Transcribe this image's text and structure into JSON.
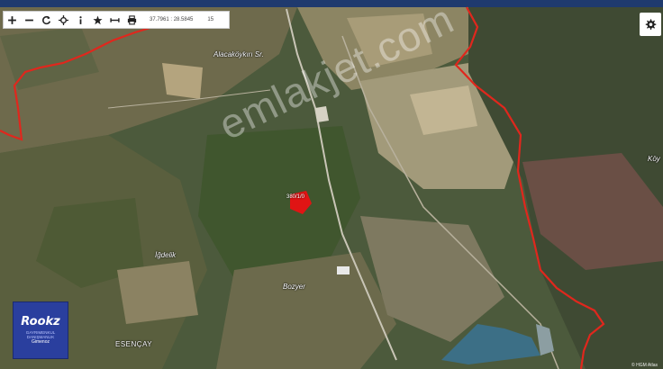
{
  "map": {
    "toolbar": {
      "tools": [
        {
          "name": "zoom-in-icon",
          "glyph": "+"
        },
        {
          "name": "zoom-out-icon",
          "glyph": "−"
        },
        {
          "name": "refresh-icon",
          "glyph": "⟳"
        },
        {
          "name": "crosshair-icon",
          "glyph": "✛"
        },
        {
          "name": "info-icon",
          "glyph": "i"
        },
        {
          "name": "star-icon",
          "glyph": "★"
        },
        {
          "name": "measure-icon",
          "glyph": "↔"
        },
        {
          "name": "print-icon",
          "glyph": "⎙"
        }
      ],
      "coordinates": "37.7961 : 28.5845",
      "zoom_level": "15"
    },
    "settings_icon": "gear-icon",
    "place_labels": {
      "alacakoykiri": "Alacaköykırı Sr.",
      "igdelik": "İğdelik",
      "bozyer": "Bozyer",
      "esencay": "ESENÇAY",
      "koy": "Köy"
    },
    "parcel_label": "380/1/0",
    "watermark": "emlakjet.com",
    "logo": {
      "main": "Rookz",
      "sub": "GAYRIMENKUL DANIŞMANLIK",
      "sub2": "Gimenoz"
    },
    "attribution": "© HGM Atlas",
    "colors": {
      "boundary": "#e0271d",
      "parcel": "#e01414",
      "logo_bg": "#2a3f9e",
      "toolbar_bg": "#ffffff"
    }
  }
}
